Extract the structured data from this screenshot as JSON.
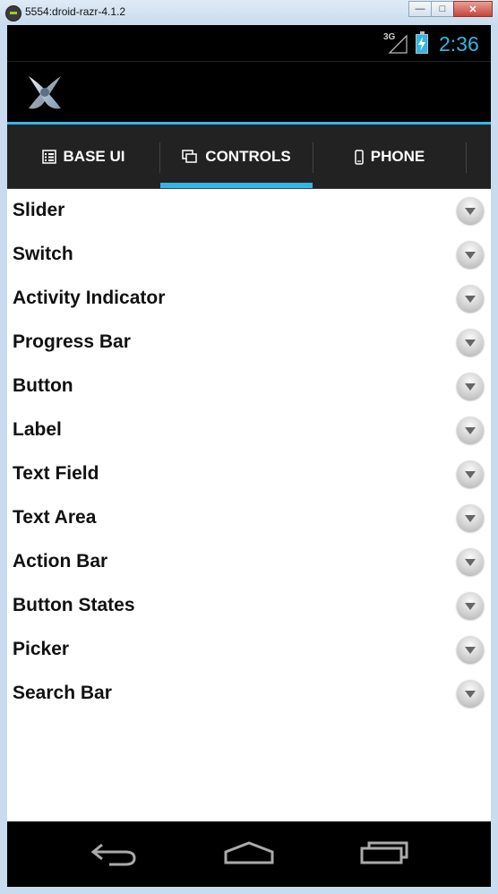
{
  "window": {
    "title": "5554:droid-razr-4.1.2",
    "minimize": "—",
    "maximize": "□",
    "close": "✕"
  },
  "status": {
    "network": "3G",
    "clock": "2:36",
    "accent": "#33b5e5"
  },
  "tabs": [
    {
      "label": "BASE UI",
      "icon": "list-icon",
      "selected": false
    },
    {
      "label": "CONTROLS",
      "icon": "windows-icon",
      "selected": true
    },
    {
      "label": "PHONE",
      "icon": "phone-icon",
      "selected": false
    }
  ],
  "list": {
    "items": [
      {
        "label": "Slider"
      },
      {
        "label": "Switch"
      },
      {
        "label": "Activity Indicator"
      },
      {
        "label": "Progress Bar"
      },
      {
        "label": "Button"
      },
      {
        "label": "Label"
      },
      {
        "label": "Text Field"
      },
      {
        "label": "Text Area"
      },
      {
        "label": "Action Bar"
      },
      {
        "label": "Button States"
      },
      {
        "label": "Picker"
      },
      {
        "label": "Search Bar"
      }
    ]
  },
  "nav": {
    "back": "back-icon",
    "home": "home-icon",
    "recents": "recents-icon"
  }
}
